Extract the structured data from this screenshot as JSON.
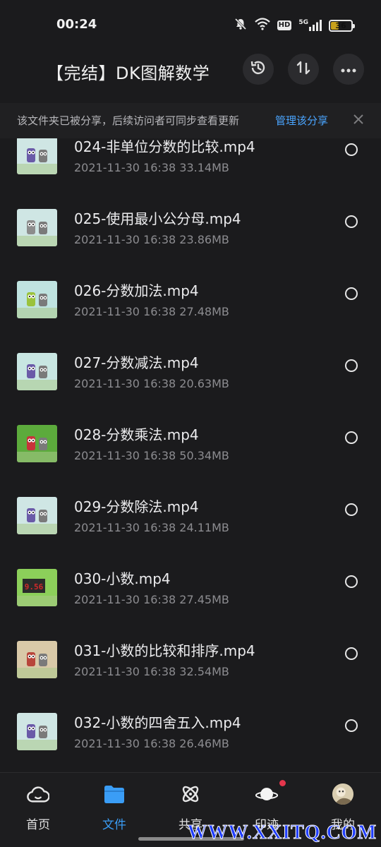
{
  "status_bar": {
    "time": "00:24",
    "network": "5G",
    "hd": "HD",
    "battery": "36",
    "battery_level": 0.36
  },
  "header": {
    "title": "【完结】DK图解数学",
    "icons": [
      "history-icon",
      "sort-icon",
      "more-icon"
    ]
  },
  "share_banner": {
    "text": "该文件夹已被分享，后续访问者可同步查看更新",
    "link": "管理该分享"
  },
  "files": [
    {
      "name": "024-非单位分数的比较.mp4",
      "meta": "2021-11-30  16:38   33.14MB",
      "thumb_colors": [
        "#cfe6e4",
        "#6a5aa8"
      ]
    },
    {
      "name": "025-使用最小公分母.mp4",
      "meta": "2021-11-30  16:38   23.86MB",
      "thumb_colors": [
        "#cfe6e4",
        "#8c8c8c"
      ]
    },
    {
      "name": "026-分数加法.mp4",
      "meta": "2021-11-30  16:38   27.48MB",
      "thumb_colors": [
        "#bfe3e0",
        "#9ac23c"
      ]
    },
    {
      "name": "027-分数减法.mp4",
      "meta": "2021-11-30  16:38   20.63MB",
      "thumb_colors": [
        "#c8e6e2",
        "#6a5aa8"
      ]
    },
    {
      "name": "028-分数乘法.mp4",
      "meta": "2021-11-30  16:38   50.34MB",
      "thumb_colors": [
        "#5cab3c",
        "#c8333a"
      ]
    },
    {
      "name": "029-分数除法.mp4",
      "meta": "2021-11-30  16:38   24.11MB",
      "thumb_colors": [
        "#cfe6e4",
        "#6a5aa8"
      ]
    },
    {
      "name": "030-小数.mp4",
      "meta": "2021-11-30  16:38   27.45MB",
      "thumb_colors": [
        "#8ccf5a",
        "#d22a2a"
      ],
      "thumb_text": "9.56"
    },
    {
      "name": "031-小数的比较和排序.mp4",
      "meta": "2021-11-30  16:38   32.54MB",
      "thumb_colors": [
        "#d9c9a8",
        "#b8453a"
      ]
    },
    {
      "name": "032-小数的四舍五入.mp4",
      "meta": "2021-11-30  16:38   26.46MB",
      "thumb_colors": [
        "#cfe6e4",
        "#6a5aa8"
      ]
    }
  ],
  "bottom_nav": [
    {
      "label": "首页",
      "icon": "cloud-home-icon",
      "active": false
    },
    {
      "label": "文件",
      "icon": "folder-icon",
      "active": true
    },
    {
      "label": "共享",
      "icon": "atom-share-icon",
      "active": false
    },
    {
      "label": "印迹",
      "icon": "planet-icon",
      "active": false,
      "badge": true
    },
    {
      "label": "我的",
      "icon": "avatar-icon",
      "active": false
    }
  ],
  "colors": {
    "accent": "#3a9df6",
    "link": "#4aa5ff",
    "background": "#1b1b1d",
    "badge": "#e5364c"
  },
  "watermark": "WWW.XXITQ.COM"
}
